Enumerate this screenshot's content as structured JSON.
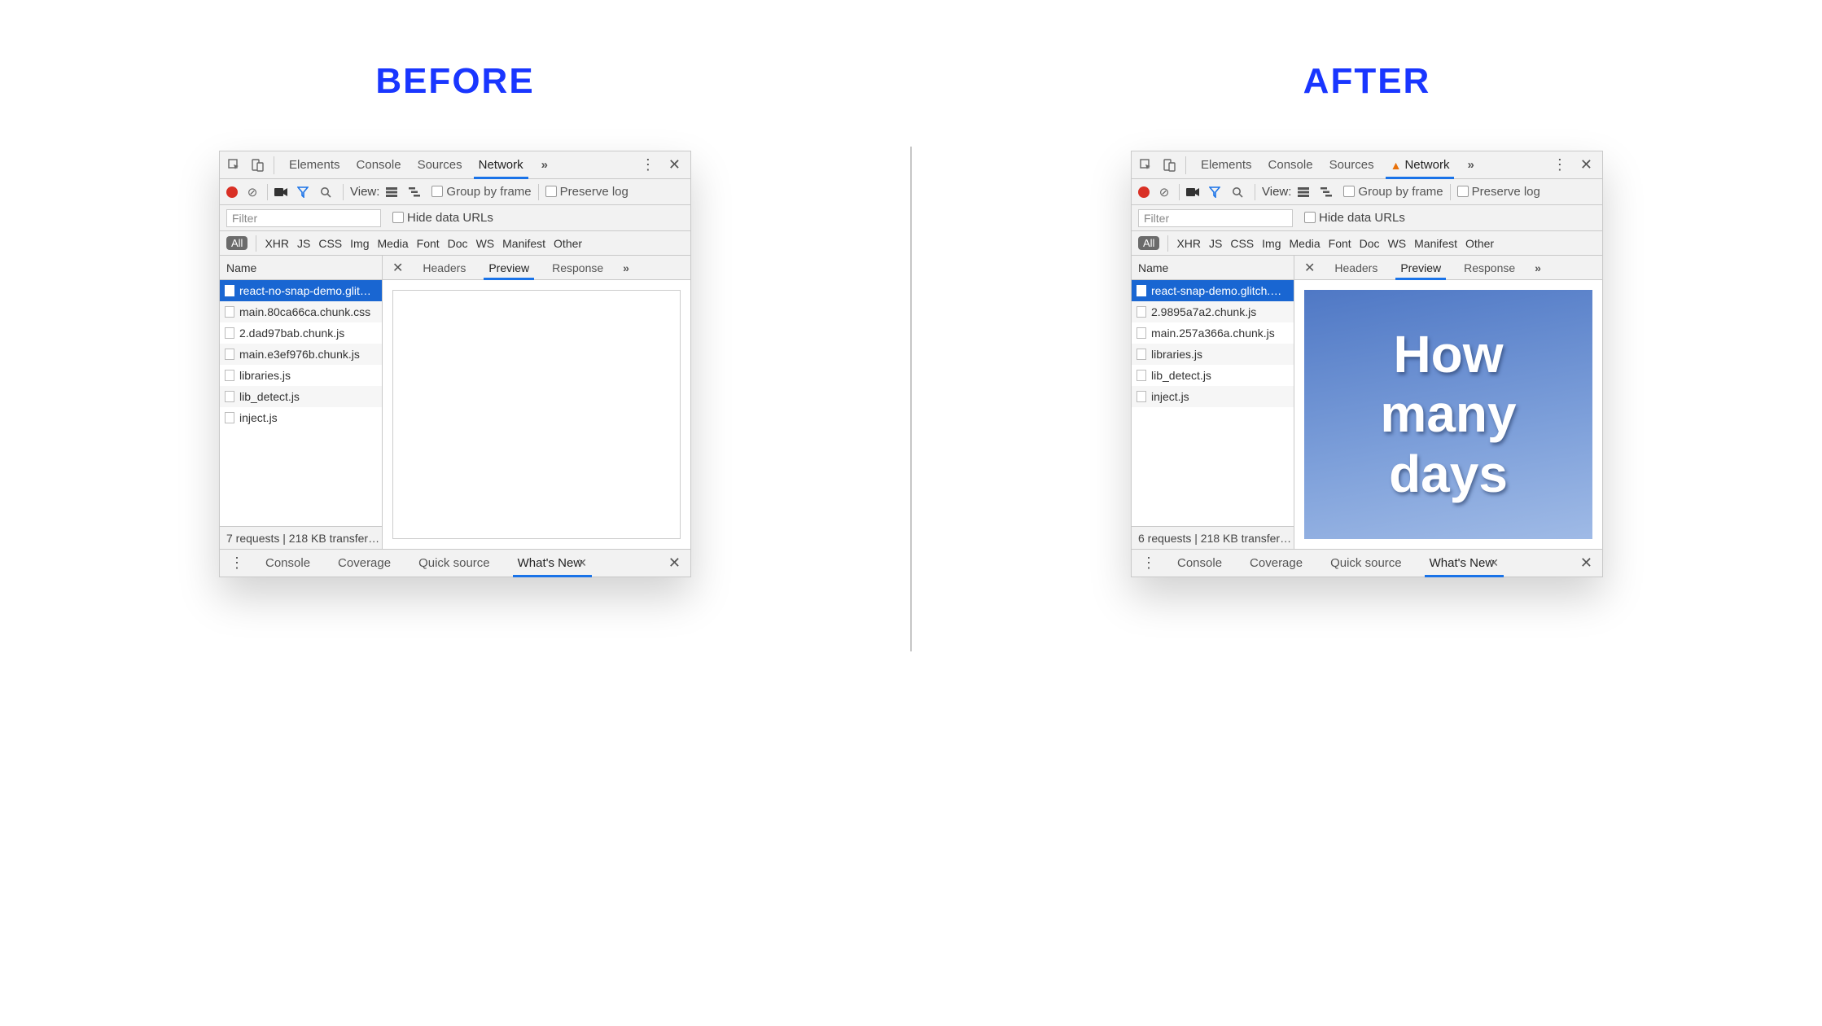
{
  "labels": {
    "before": "BEFORE",
    "after": "AFTER"
  },
  "devtools": {
    "main_tabs": [
      "Elements",
      "Console",
      "Sources",
      "Network"
    ],
    "active_main_tab": "Network",
    "toolbar": {
      "view_label": "View:",
      "group_by_frame": "Group by frame",
      "preserve_log": "Preserve log"
    },
    "filter": {
      "placeholder": "Filter",
      "hide_data_urls": "Hide data URLs"
    },
    "type_filters": [
      "XHR",
      "JS",
      "CSS",
      "Img",
      "Media",
      "Font",
      "Doc",
      "WS",
      "Manifest",
      "Other"
    ],
    "type_all": "All",
    "request_list_header": "Name",
    "detail_tabs": [
      "Headers",
      "Preview",
      "Response"
    ],
    "active_detail_tab": "Preview",
    "drawer_tabs": [
      "Console",
      "Coverage",
      "Quick source",
      "What's New"
    ],
    "active_drawer_tab": "What's New"
  },
  "before_panel": {
    "has_warning": false,
    "requests": [
      "react-no-snap-demo.glit…",
      "main.80ca66ca.chunk.css",
      "2.dad97bab.chunk.js",
      "main.e3ef976b.chunk.js",
      "libraries.js",
      "lib_detect.js",
      "inject.js"
    ],
    "status_line": "7 requests | 218 KB transfer…",
    "preview_text": ""
  },
  "after_panel": {
    "has_warning": true,
    "requests": [
      "react-snap-demo.glitch.…",
      "2.9895a7a2.chunk.js",
      "main.257a366a.chunk.js",
      "libraries.js",
      "lib_detect.js",
      "inject.js"
    ],
    "status_line": "6 requests | 218 KB transfer…",
    "preview_text": "How\nmany\ndays"
  }
}
